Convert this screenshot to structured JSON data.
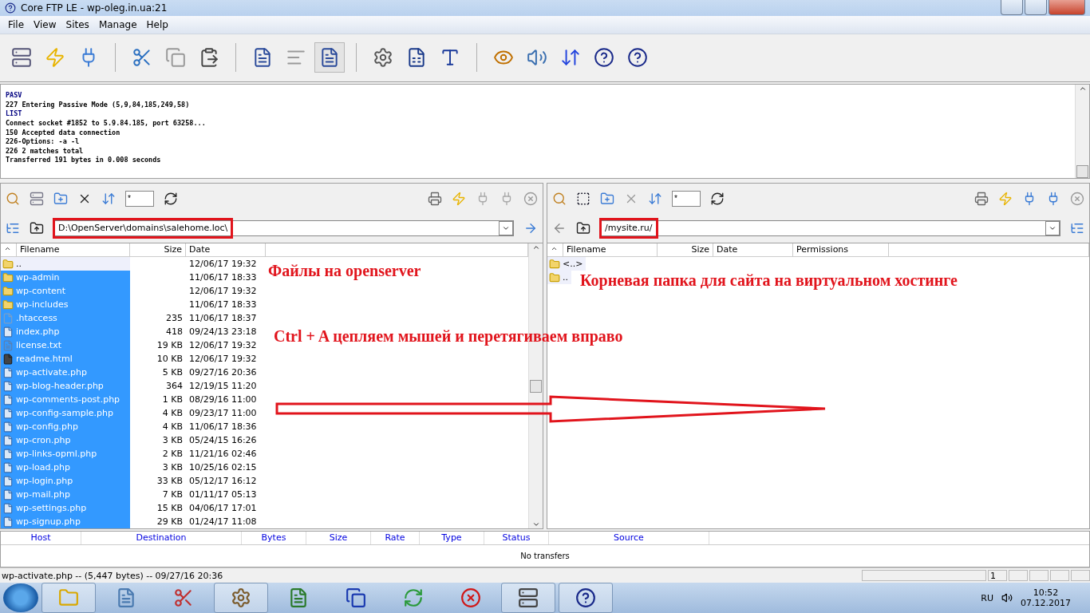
{
  "window": {
    "title": "Core FTP LE - wp-oleg.in.ua:21"
  },
  "menu": [
    "File",
    "View",
    "Sites",
    "Manage",
    "Help"
  ],
  "toolbar": [
    {
      "pressed": false
    },
    {
      "pressed": false
    },
    {
      "pressed": false
    },
    {
      "pressed": false
    },
    {
      "pressed": false
    },
    {
      "pressed": false
    },
    {
      "pressed": false
    },
    {
      "pressed": false
    },
    {
      "pressed": true
    },
    {
      "pressed": false
    },
    {
      "pressed": false
    },
    {
      "pressed": false
    },
    {
      "pressed": false
    },
    {
      "pressed": false
    },
    {
      "pressed": false
    },
    {
      "pressed": false
    },
    {
      "pressed": false
    }
  ],
  "log": [
    {
      "kind": "command",
      "text": "PASV"
    },
    {
      "kind": "response",
      "text": "227 Entering Passive Mode (5,9,84,185,249,58)"
    },
    {
      "kind": "command",
      "text": "LIST"
    },
    {
      "kind": "response",
      "text": "Connect socket #1852 to 5.9.84.185, port 63258..."
    },
    {
      "kind": "response",
      "text": "150 Accepted data connection"
    },
    {
      "kind": "response",
      "text": "226-Options: -a -l"
    },
    {
      "kind": "response",
      "text": "226 2 matches total"
    },
    {
      "kind": "response",
      "text": "Transferred 191 bytes in 0.008 seconds"
    }
  ],
  "panes": [
    {
      "kind": "local",
      "filter": "*",
      "path": "D:\\OpenServer\\domains\\salehome.loc\\",
      "highlight": true,
      "columns": [
        "Filename",
        "Size",
        "Date"
      ],
      "rows": [
        {
          "kind": "folder",
          "name": "..",
          "size": "",
          "date": "12/06/17  19:32",
          "selected": false
        },
        {
          "kind": "folder",
          "name": "wp-admin",
          "size": "",
          "date": "11/06/17  18:33",
          "selected": true
        },
        {
          "kind": "folder",
          "name": "wp-content",
          "size": "",
          "date": "12/06/17  19:32",
          "selected": true
        },
        {
          "kind": "folder",
          "name": "wp-includes",
          "size": "",
          "date": "11/06/17  18:33",
          "selected": true
        },
        {
          "kind": "file",
          "name": ".htaccess",
          "size": "235",
          "date": "11/06/17  18:37",
          "selected": true
        },
        {
          "kind": "php",
          "name": "index.php",
          "size": "418",
          "date": "09/24/13  23:18",
          "selected": true
        },
        {
          "kind": "text",
          "name": "license.txt",
          "size": "19 KB",
          "date": "12/06/17  19:32",
          "selected": true
        },
        {
          "kind": "html",
          "name": "readme.html",
          "size": "10 KB",
          "date": "12/06/17  19:32",
          "selected": true
        },
        {
          "kind": "php",
          "name": "wp-activate.php",
          "size": "5 KB",
          "date": "09/27/16  20:36",
          "selected": true
        },
        {
          "kind": "php",
          "name": "wp-blog-header.php",
          "size": "364",
          "date": "12/19/15  11:20",
          "selected": true
        },
        {
          "kind": "php",
          "name": "wp-comments-post.php",
          "size": "1 KB",
          "date": "08/29/16  11:00",
          "selected": true
        },
        {
          "kind": "php",
          "name": "wp-config-sample.php",
          "size": "4 KB",
          "date": "09/23/17  11:00",
          "selected": true
        },
        {
          "kind": "php",
          "name": "wp-config.php",
          "size": "4 KB",
          "date": "11/06/17  18:36",
          "selected": true
        },
        {
          "kind": "php",
          "name": "wp-cron.php",
          "size": "3 KB",
          "date": "05/24/15  16:26",
          "selected": true
        },
        {
          "kind": "php",
          "name": "wp-links-opml.php",
          "size": "2 KB",
          "date": "11/21/16  02:46",
          "selected": true
        },
        {
          "kind": "php",
          "name": "wp-load.php",
          "size": "3 KB",
          "date": "10/25/16  02:15",
          "selected": true
        },
        {
          "kind": "php",
          "name": "wp-login.php",
          "size": "33 KB",
          "date": "05/12/17  16:12",
          "selected": true
        },
        {
          "kind": "php",
          "name": "wp-mail.php",
          "size": "7 KB",
          "date": "01/11/17  05:13",
          "selected": true
        },
        {
          "kind": "php",
          "name": "wp-settings.php",
          "size": "15 KB",
          "date": "04/06/17  17:01",
          "selected": true
        },
        {
          "kind": "php",
          "name": "wp-signup.php",
          "size": "29 KB",
          "date": "01/24/17  11:08",
          "selected": true
        }
      ]
    },
    {
      "kind": "remote",
      "filter": "*",
      "path": "/mysite.ru/",
      "highlight": true,
      "columns": [
        "Filename",
        "Size",
        "Date",
        "Permissions"
      ],
      "rows": [
        {
          "kind": "folder",
          "name": "<..>",
          "size": "",
          "date": "",
          "selected": false
        },
        {
          "kind": "folder",
          "name": "..",
          "size": "",
          "date": "",
          "selected": false
        }
      ]
    }
  ],
  "annotations": [
    {
      "text": "Файлы на openserver"
    },
    {
      "text": "Корневая папка для сайта на виртуальном хостинге"
    },
    {
      "text": "Ctrl + A цепляем мышей и перетягиваем вправо"
    }
  ],
  "transfers": {
    "columns": [
      "Host",
      "Destination",
      "Bytes",
      "Size",
      "Rate",
      "Type",
      "Status",
      "Source"
    ],
    "empty": "No transfers"
  },
  "status_bar": {
    "text": "wp-activate.php -- (5,447 bytes) -- 09/27/16  20:36",
    "count": "1"
  },
  "taskbar": {
    "language": "RU",
    "time": "10:52",
    "date": "07.12.2017"
  }
}
